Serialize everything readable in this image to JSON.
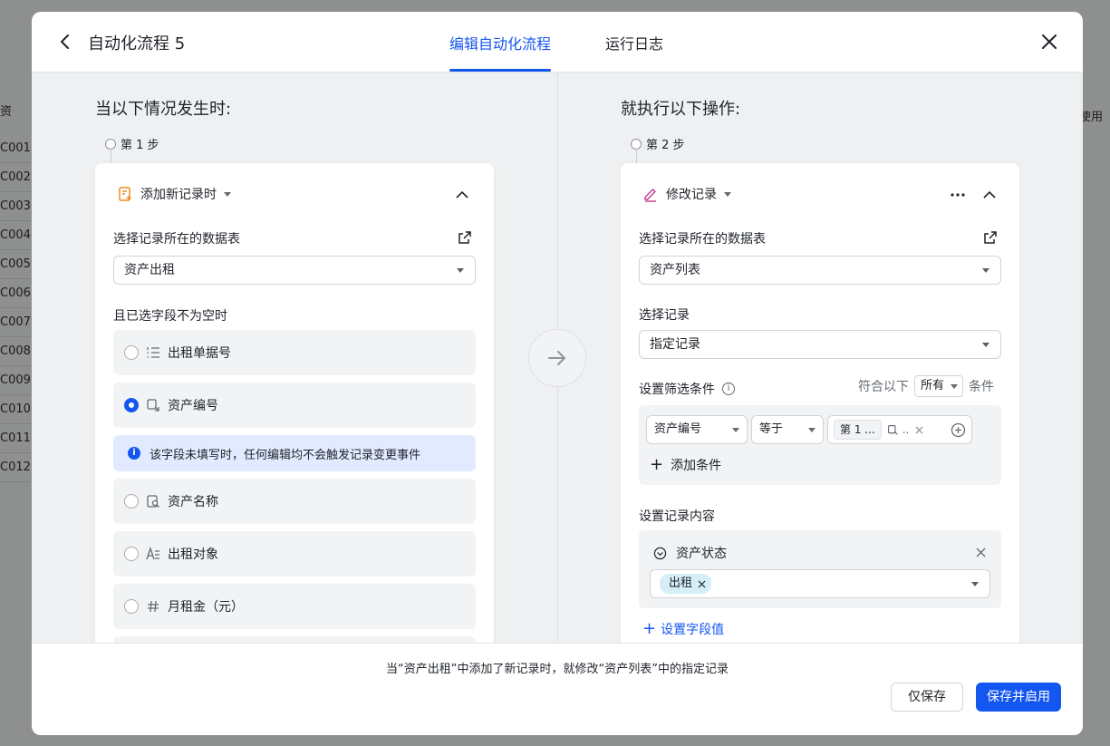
{
  "background": {
    "header_label": "资",
    "rows": [
      "C001",
      "C002",
      "C003",
      "C004",
      "C005",
      "C006",
      "C007",
      "C008",
      "C009",
      "C010",
      "C011",
      "C012"
    ],
    "right_label": "使用"
  },
  "header": {
    "title": "自动化流程 5",
    "tabs": [
      {
        "label": "编辑自动化流程",
        "active": true
      },
      {
        "label": "运行日志",
        "active": false
      }
    ]
  },
  "trigger": {
    "section_title": "当以下情况发生时:",
    "step_label": "第 1 步",
    "card_title": "添加新记录时",
    "table_label": "选择记录所在的数据表",
    "table_value": "资产出租",
    "fields_label": "且已选字段不为空时",
    "fields": [
      {
        "label": "出租单据号",
        "checked": false,
        "icon": "numbered-list-icon"
      },
      {
        "label": "资产编号",
        "checked": true,
        "icon": "link-field-icon"
      },
      {
        "label": "资产名称",
        "checked": false,
        "icon": "lookup-field-icon"
      },
      {
        "label": "出租对象",
        "checked": false,
        "icon": "text-field-icon"
      },
      {
        "label": "月租金（元）",
        "checked": false,
        "icon": "hash-icon"
      }
    ],
    "info_text": "该字段未填写时，任何编辑均不会触发记录变更事件"
  },
  "action": {
    "section_title": "就执行以下操作:",
    "step_label": "第 2 步",
    "card_title": "修改记录",
    "table_label": "选择记录所在的数据表",
    "table_value": "资产列表",
    "record_label": "选择记录",
    "record_value": "指定记录",
    "filter_label": "设置筛选条件",
    "match_prefix": "符合以下",
    "match_value": "所有",
    "match_suffix": "条件",
    "filter": {
      "field": "资产编号",
      "operator": "等于",
      "value_chip_1": "第 1 ...",
      "value_chip_2": ".."
    },
    "add_condition": "添加条件",
    "content_label": "设置记录内容",
    "content_field": "资产状态",
    "content_tag": "出租",
    "set_field_value": "设置字段值"
  },
  "footer": {
    "description": "当“资产出租”中添加了新记录时，就修改“资产列表”中的指定记录",
    "save_label": "仅保存",
    "save_enable_label": "保存并启用"
  },
  "colors": {
    "primary": "#1456f0",
    "info_bg": "#e1eaff",
    "tag_bg": "#d5eef7"
  }
}
